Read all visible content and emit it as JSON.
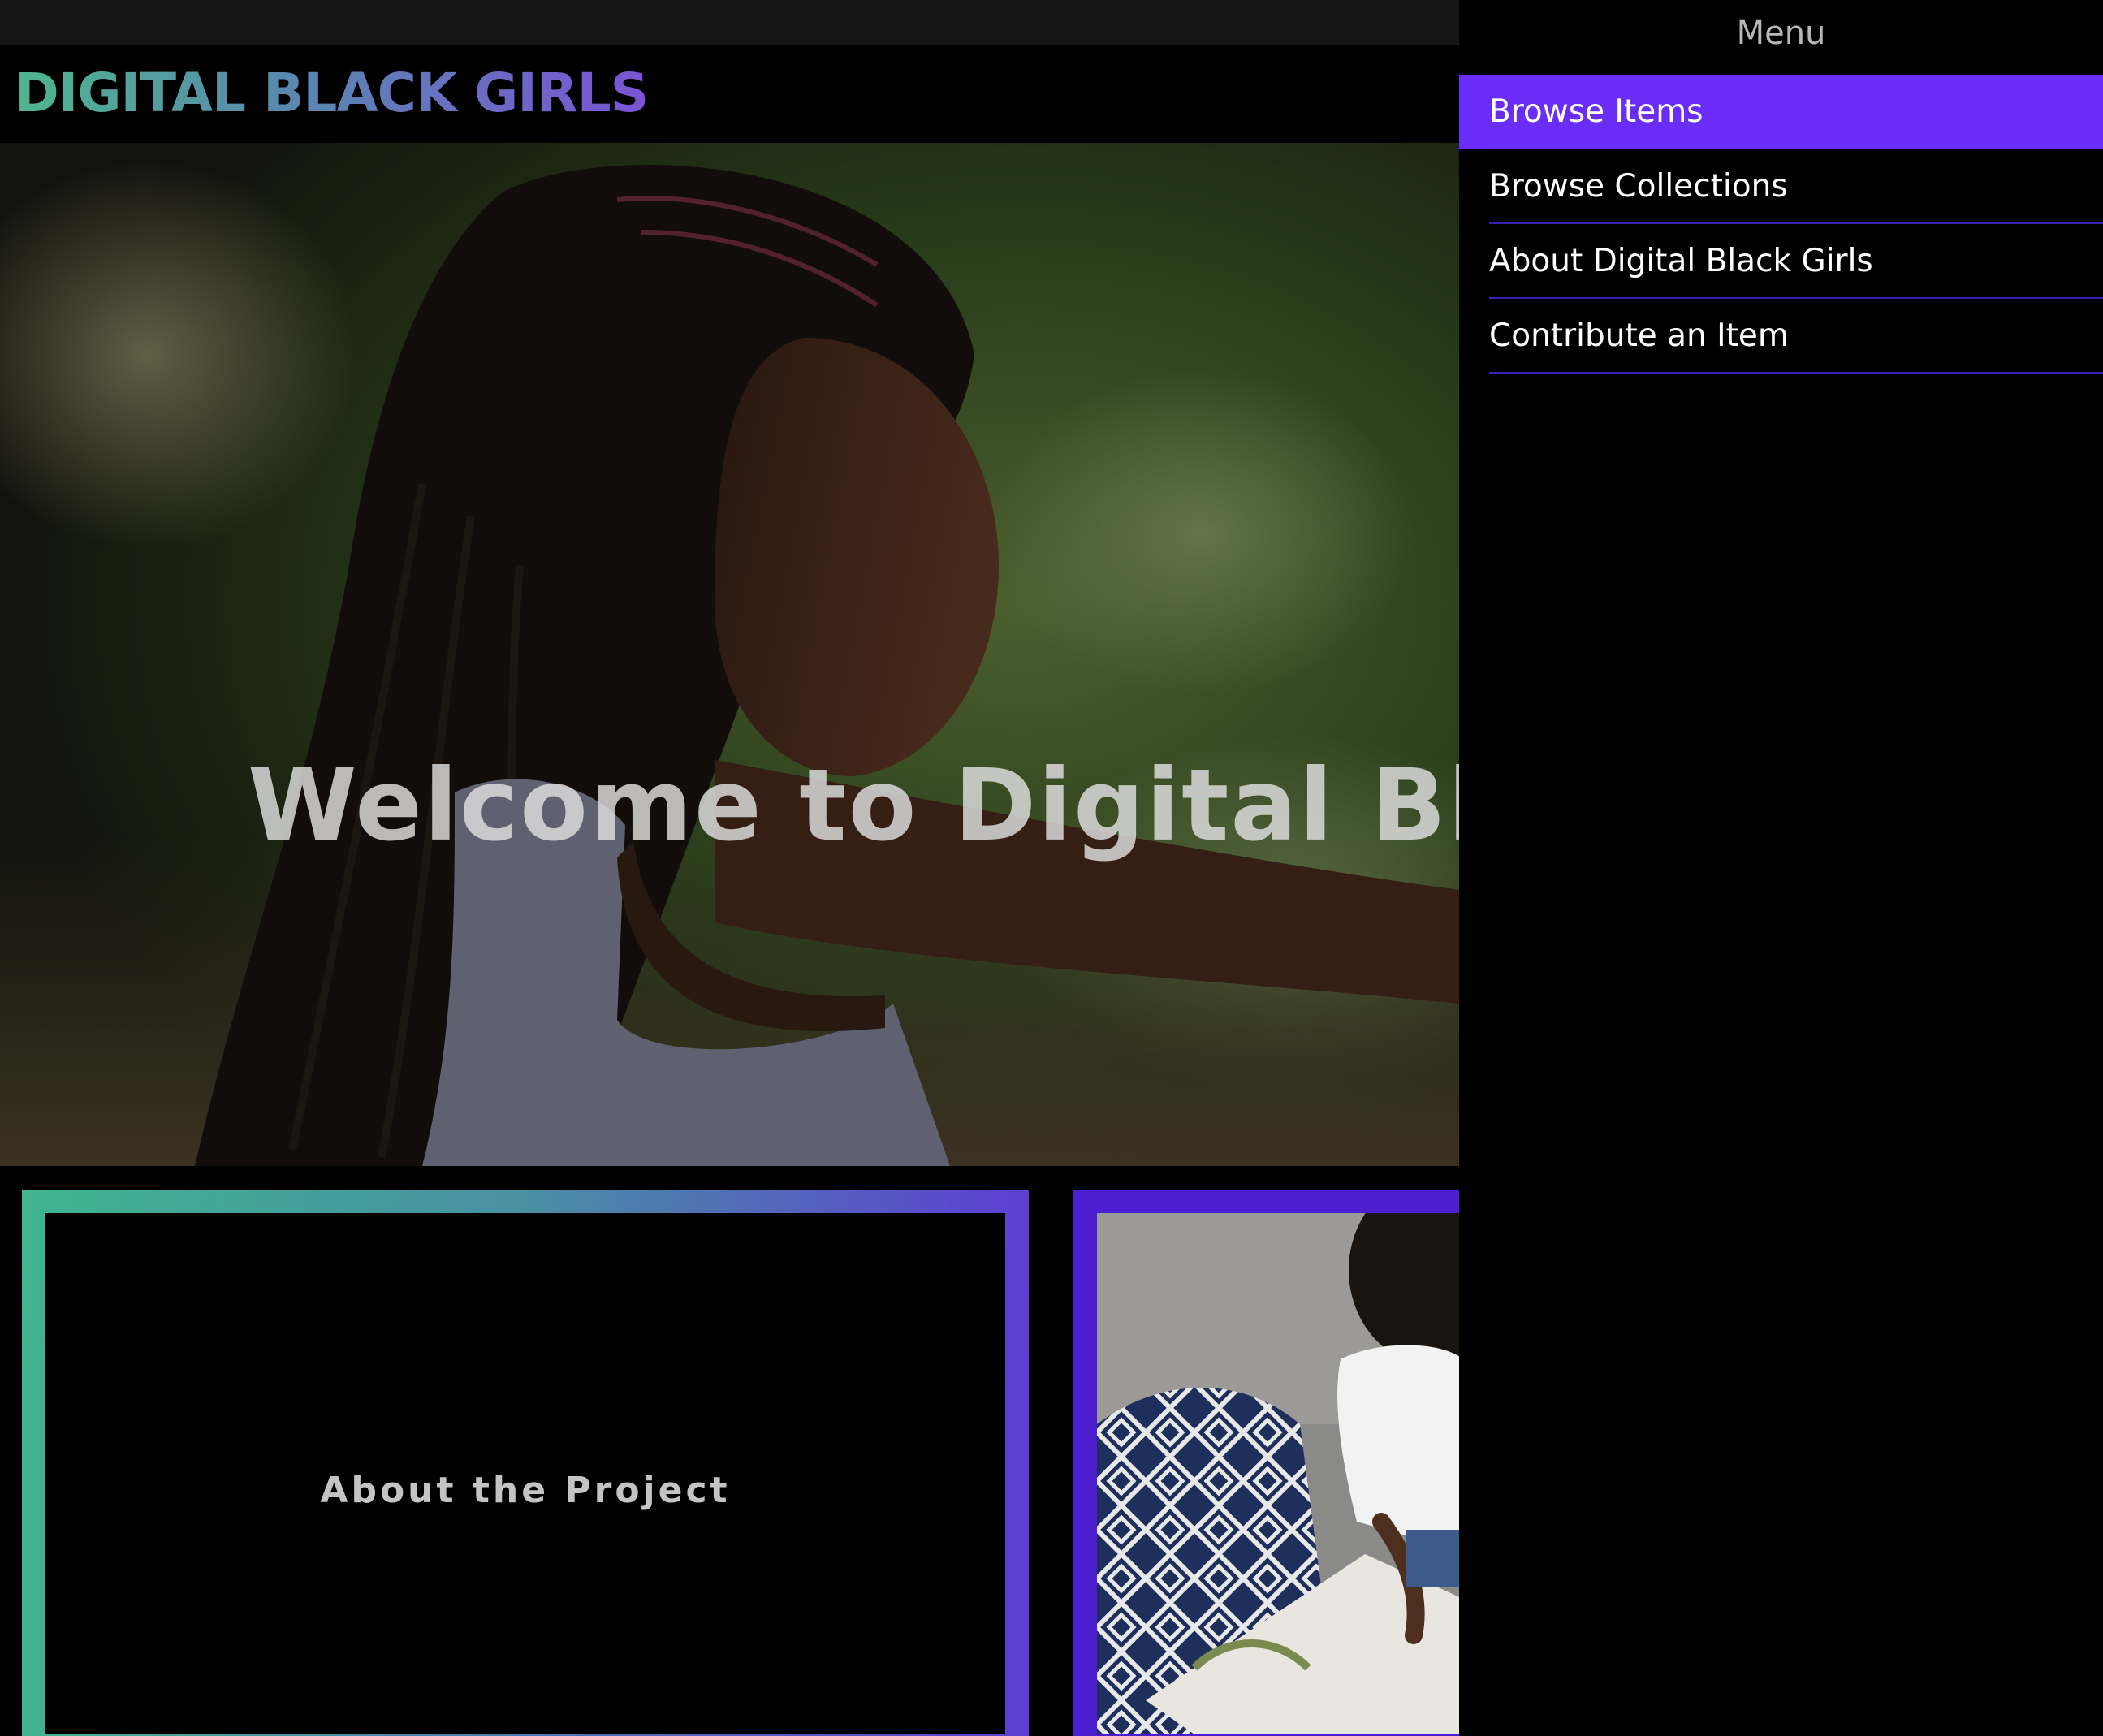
{
  "site": {
    "logo_text": "DIGITAL BLACK GIRLS"
  },
  "hero": {
    "title": "Welcome to Digital Black Girls"
  },
  "cards": {
    "about_label": "About the Project"
  },
  "menu": {
    "title": "Menu",
    "items": [
      {
        "label": "Browse Items",
        "active": true
      },
      {
        "label": "Browse Collections",
        "active": false
      },
      {
        "label": "About Digital Black Girls",
        "active": false
      },
      {
        "label": "Contribute an Item",
        "active": false
      }
    ]
  },
  "colors": {
    "menu_active": "#6a2cf7",
    "menu_divider": "#3b1fb0",
    "card_frame_purple": "#4b1fd0",
    "logo_gradient_start": "#4fb58e",
    "logo_gradient_end": "#7a54d4"
  }
}
